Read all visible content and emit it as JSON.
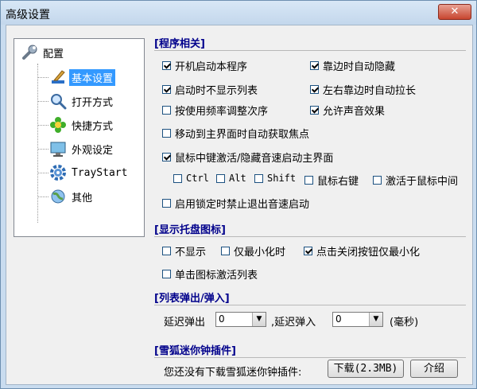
{
  "window": {
    "title": "高级设置",
    "close_glyph": "✕"
  },
  "tree": {
    "root": {
      "label": "配置",
      "icon": "wrench-icon"
    },
    "items": [
      {
        "label": "基本设置",
        "icon": "brush-icon",
        "selected": true
      },
      {
        "label": "打开方式",
        "icon": "magnifier-icon",
        "selected": false
      },
      {
        "label": "快捷方式",
        "icon": "flower-icon",
        "selected": false
      },
      {
        "label": "外观设定",
        "icon": "monitor-icon",
        "selected": false
      },
      {
        "label": "TrayStart",
        "icon": "gear-icon",
        "selected": false
      },
      {
        "label": "其他",
        "icon": "globe-icon",
        "selected": false
      }
    ]
  },
  "sections": {
    "program": "[程序相关]",
    "tray": "[显示托盘图标]",
    "popup": "[列表弹出/弹入]",
    "plugin": "[雪狐迷你钟插件]"
  },
  "program": {
    "autostart": {
      "label": "开机启动本程序",
      "checked": true
    },
    "edge_hide": {
      "label": "靠边时自动隐藏",
      "checked": true
    },
    "no_list_on_start": {
      "label": "启动时不显示列表",
      "checked": true
    },
    "edge_stretch": {
      "label": "左右靠边时自动拉长",
      "checked": true
    },
    "sort_by_freq": {
      "label": "按使用频率调整次序",
      "checked": false
    },
    "sound": {
      "label": "允许声音效果",
      "checked": true
    },
    "focus_on_hover": {
      "label": "移动到主界面时自动获取焦点",
      "checked": false
    },
    "middle_click": {
      "label": "鼠标中键激活/隐藏音速启动主界面",
      "checked": true
    },
    "mod_ctrl": {
      "label": "Ctrl",
      "checked": false
    },
    "mod_alt": {
      "label": "Alt",
      "checked": false
    },
    "mod_shift": {
      "label": "Shift",
      "checked": false
    },
    "right_button": {
      "label": "鼠标右键",
      "checked": false
    },
    "activate_middle": {
      "label": "激活于鼠标中间",
      "checked": false
    },
    "lock_no_exit": {
      "label": "启用锁定时禁止退出音速启动",
      "checked": false
    }
  },
  "tray": {
    "hide": {
      "label": "不显示",
      "checked": false
    },
    "only_min": {
      "label": "仅最小化时",
      "checked": false
    },
    "close_min": {
      "label": "点击关闭按钮仅最小化",
      "checked": true
    },
    "single_click": {
      "label": "单击图标激活列表",
      "checked": false
    }
  },
  "popup": {
    "delay_out_label": "延迟弹出",
    "delay_out_value": "0",
    "delay_in_label": ",延迟弹入",
    "delay_in_value": "0",
    "unit": "(毫秒)",
    "arrow": "▼"
  },
  "plugin": {
    "note": "您还没有下载雪狐迷你钟插件:",
    "download": "下载(2.3MB)",
    "intro": "介绍"
  }
}
